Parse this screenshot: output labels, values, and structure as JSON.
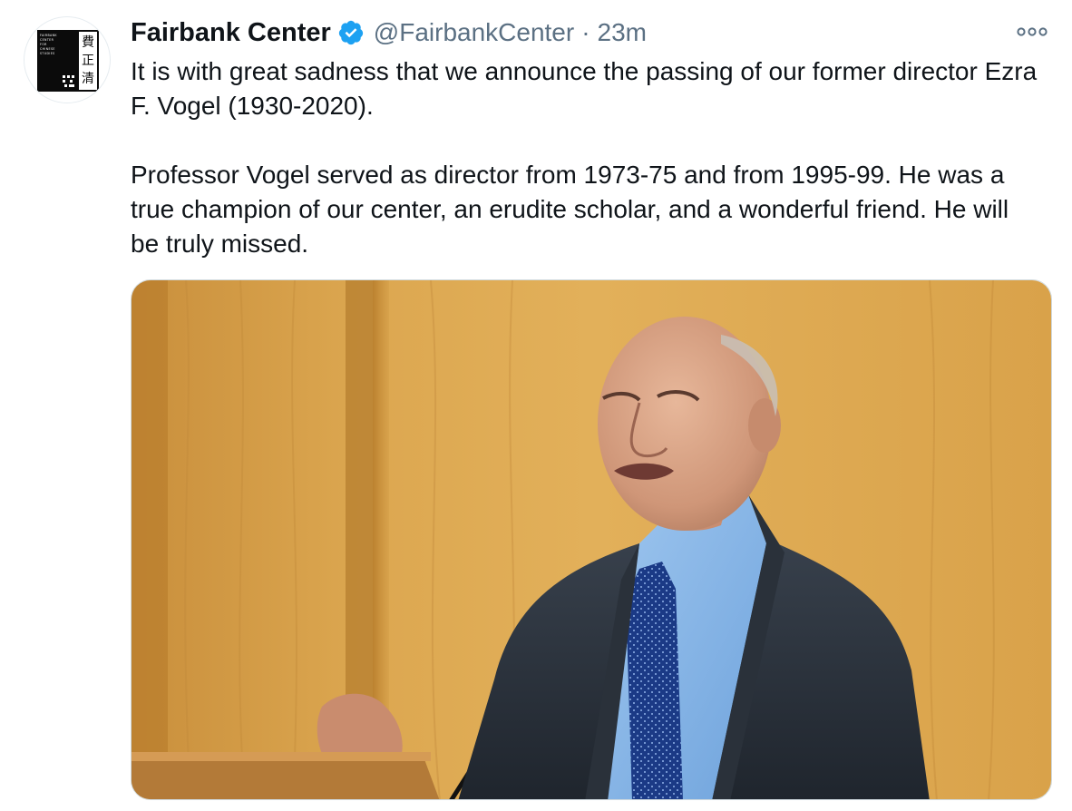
{
  "author": {
    "display_name": "Fairbank Center",
    "handle": "@FairbankCenter",
    "separator": "·",
    "timestamp": "23m",
    "verified": true,
    "avatar_logo_text": [
      "FAIRBANK",
      "CENTER",
      "FOR",
      "CHINESE",
      "STUDIES"
    ],
    "avatar_logo_chinese": [
      "費",
      "正",
      "清"
    ]
  },
  "tweet": {
    "paragraph_1": "It is with great sadness that we announce the passing of our former director Ezra F. Vogel (1930-2020).",
    "paragraph_2": "Professor Vogel served as director from 1973-75 and from 1995-99. He was a true champion of our center, an erudite scholar, and a wonderful friend. He will be truly missed."
  },
  "icons": {
    "verified": "verified-badge-icon",
    "more": "more-options-icon"
  },
  "colors": {
    "verified_blue": "#1da1f2",
    "secondary_text": "#5b7083",
    "wood_background": "#d9a24a"
  }
}
